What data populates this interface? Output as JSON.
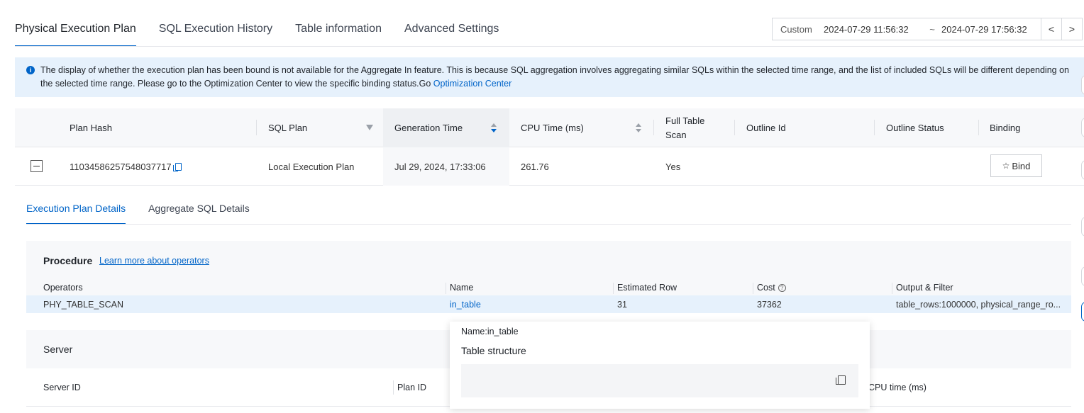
{
  "tabs": [
    {
      "label": "Physical Execution Plan",
      "active": true
    },
    {
      "label": "SQL Execution History",
      "active": false
    },
    {
      "label": "Table information",
      "active": false
    },
    {
      "label": "Advanced Settings",
      "active": false
    }
  ],
  "time_range": {
    "mode": "Custom",
    "start": "2024-07-29 11:56:32",
    "separator": "~",
    "end": "2024-07-29 17:56:32",
    "prev": "<",
    "next": ">"
  },
  "banner": {
    "text": "The display of whether the execution plan has been bound is not available for the Aggregate In feature. This is because SQL aggregation involves aggregating similar SQLs within the selected time range, and the list of included SQLs will be different depending on the selected time range. Please go to the Optimization Center to view the specific binding status.Go",
    "link": "Optimization Center",
    "icon": "info-icon"
  },
  "plan_table": {
    "headers": {
      "plan_hash": "Plan Hash",
      "sql_plan": "SQL Plan",
      "generation_time": "Generation Time",
      "cpu_time": "CPU Time (ms)",
      "full_table_scan_1": "Full Table",
      "full_table_scan_2": "Scan",
      "outline_id": "Outline Id",
      "outline_status": "Outline Status",
      "binding": "Binding"
    },
    "row": {
      "plan_hash": "11034586257548037717",
      "sql_plan": "Local Execution Plan",
      "generation_time": "Jul 29, 2024, 17:33:06",
      "cpu_time": "261.76",
      "full_table_scan": "Yes",
      "outline_id": "",
      "outline_status": "",
      "bind_label": "Bind"
    }
  },
  "sub_tabs": [
    {
      "label": "Execution Plan Details",
      "active": true
    },
    {
      "label": "Aggregate SQL Details",
      "active": false
    }
  ],
  "procedure": {
    "title": "Procedure",
    "link": "Learn more about operators",
    "headers": {
      "operators": "Operators",
      "name": "Name",
      "estimated_row": "Estimated Row",
      "cost": "Cost",
      "output_filter": "Output & Filter"
    },
    "row": {
      "operator": "PHY_TABLE_SCAN",
      "name": "in_table",
      "estimated_row": "31",
      "cost": "37362",
      "output_filter": "table_rows:1000000, physical_range_ro..."
    }
  },
  "server": {
    "title": "Server",
    "headers": {
      "server_id": "Server ID",
      "plan_id": "Plan ID",
      "cpu_time": "CPU time (ms)"
    }
  },
  "popover": {
    "name_line": "Name:in_table",
    "title": "Table structure"
  }
}
